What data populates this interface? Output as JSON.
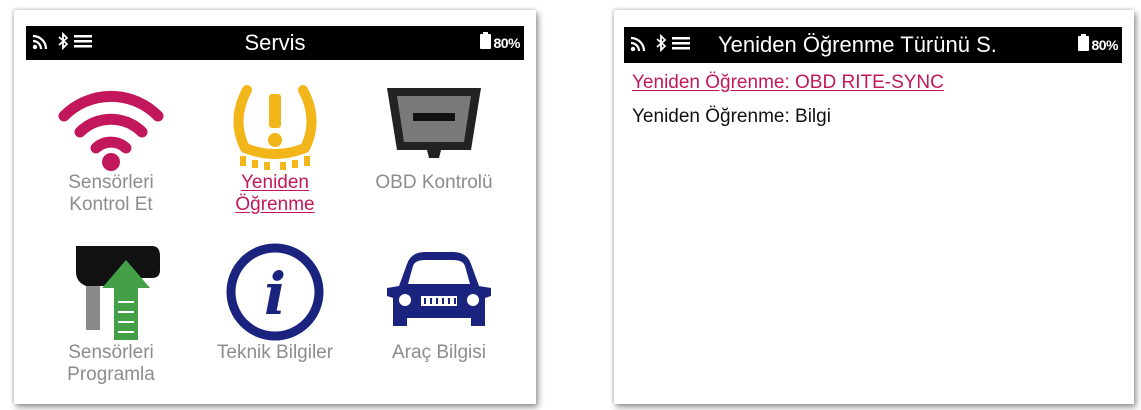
{
  "left_screen": {
    "title": "Servis",
    "battery": "80%",
    "status_icons": [
      "signal-icon",
      "bluetooth-icon",
      "menu-icon"
    ],
    "tiles": [
      {
        "label_line1": "Sensörleri",
        "label_line2": "Kontrol Et",
        "icon": "wifi-sensor-icon",
        "selected": false
      },
      {
        "label_line1": "Yeniden",
        "label_line2": "Öğrenme",
        "icon": "tpms-warning-icon",
        "selected": true
      },
      {
        "label_line1": "OBD Kontrolü",
        "label_line2": "",
        "icon": "obd-connector-icon",
        "selected": false
      },
      {
        "label_line1": "Sensörleri",
        "label_line2": "Programla",
        "icon": "program-sensor-icon",
        "selected": false
      },
      {
        "label_line1": "Teknik Bilgiler",
        "label_line2": "",
        "icon": "info-icon",
        "selected": false
      },
      {
        "label_line1": "Araç Bilgisi",
        "label_line2": "",
        "icon": "car-icon",
        "selected": false
      }
    ]
  },
  "right_screen": {
    "title": "Yeniden Öğrenme Türünü S.",
    "battery": "80%",
    "status_icons": [
      "signal-icon",
      "bluetooth-icon",
      "menu-icon"
    ],
    "items": [
      {
        "label": "Yeniden Öğrenme: OBD RITE-SYNC",
        "selected": true
      },
      {
        "label": "Yeniden Öğrenme: Bilgi",
        "selected": false
      }
    ]
  },
  "colors": {
    "accent": "#c2185b",
    "wifi": "#c2185b",
    "tpms": "#f2b51a",
    "navy": "#1a237e",
    "green": "#43a047",
    "label_gray": "#8c8c8c",
    "statusbar": "#000000"
  }
}
